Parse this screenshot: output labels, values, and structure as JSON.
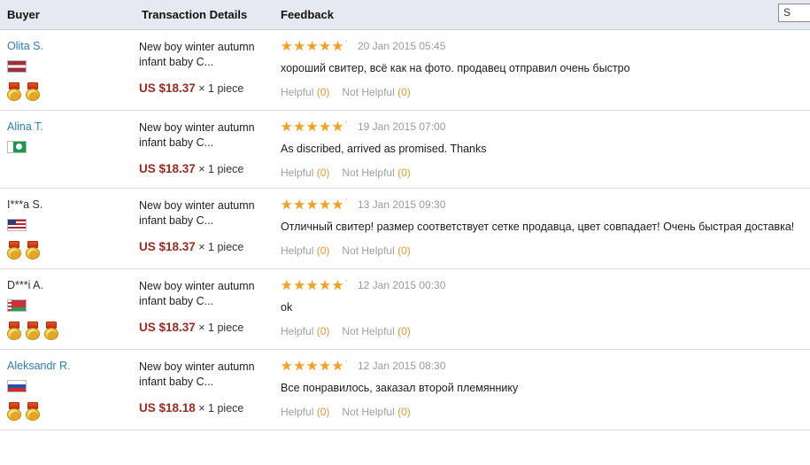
{
  "table": {
    "columns": [
      {
        "key": "buyer",
        "label": "Buyer"
      },
      {
        "key": "transaction",
        "label": "Transaction Details"
      },
      {
        "key": "feedback",
        "label": "Feedback"
      }
    ],
    "sort_control": {
      "visible_text": "S"
    }
  },
  "labels": {
    "helpful": "Helpful",
    "not_helpful": "Not Helpful",
    "stars_glyphs": "★★★★★",
    "star_tick": "'",
    "qty_separator": "×"
  },
  "colors": {
    "header_bg": "#e7e9f2",
    "buyer_link": "#2b7db5",
    "price": "#9e2a20",
    "star": "#f5a11e",
    "muted_action": "#a0a0a0",
    "action_count": "#e8962a",
    "date": "#9b9b9b",
    "row_divider": "#dcdcdc"
  },
  "rows": [
    {
      "buyer": {
        "name": "Olita S.",
        "is_link": true,
        "flag": "latvia-flag",
        "flag_class": "flag-lv",
        "medals": 2
      },
      "transaction": {
        "item_title": "New boy winter autumn infant baby C...",
        "price": "US $18.37",
        "quantity": "× 1 piece"
      },
      "feedback": {
        "rating": 5,
        "date": "20 Jan 2015 05:45",
        "comment": "хороший свитер, всё как на фото. продавец отправил очень быстро",
        "helpful_count": "(0)",
        "not_helpful_count": "(0)"
      }
    },
    {
      "buyer": {
        "name": "Alina T.",
        "is_link": true,
        "flag": "pakistan-flag",
        "flag_class": "flag-pk",
        "medals": 0
      },
      "transaction": {
        "item_title": "New boy winter autumn infant baby C...",
        "price": "US $18.37",
        "quantity": "× 1 piece"
      },
      "feedback": {
        "rating": 5,
        "date": "19 Jan 2015 07:00",
        "comment": "As discribed, arrived as promised. Thanks",
        "helpful_count": "(0)",
        "not_helpful_count": "(0)"
      }
    },
    {
      "buyer": {
        "name": "I***a S.",
        "is_link": false,
        "flag": "united-states-flag",
        "flag_class": "flag-us",
        "medals": 2
      },
      "transaction": {
        "item_title": "New boy winter autumn infant baby C...",
        "price": "US $18.37",
        "quantity": "× 1 piece"
      },
      "feedback": {
        "rating": 5,
        "date": "13 Jan 2015 09:30",
        "comment": "Отличный свитер! размер соответствует сетке продавца, цвет совпадает! Очень быстрая доставка!",
        "helpful_count": "(0)",
        "not_helpful_count": "(0)"
      }
    },
    {
      "buyer": {
        "name": "D***i A.",
        "is_link": false,
        "flag": "belarus-flag",
        "flag_class": "flag-by",
        "medals": 3
      },
      "transaction": {
        "item_title": "New boy winter autumn infant baby C...",
        "price": "US $18.37",
        "quantity": "× 1 piece"
      },
      "feedback": {
        "rating": 5,
        "date": "12 Jan 2015 00:30",
        "comment": "ok",
        "helpful_count": "(0)",
        "not_helpful_count": "(0)"
      }
    },
    {
      "buyer": {
        "name": "Aleksandr R.",
        "is_link": true,
        "flag": "russia-flag",
        "flag_class": "flag-ru",
        "medals": 2
      },
      "transaction": {
        "item_title": "New boy winter autumn infant baby C...",
        "price": "US $18.18",
        "quantity": "× 1 piece"
      },
      "feedback": {
        "rating": 5,
        "date": "12 Jan 2015 08:30",
        "comment": "Все понравилось, заказал второй племяннику",
        "helpful_count": "(0)",
        "not_helpful_count": "(0)"
      }
    }
  ]
}
